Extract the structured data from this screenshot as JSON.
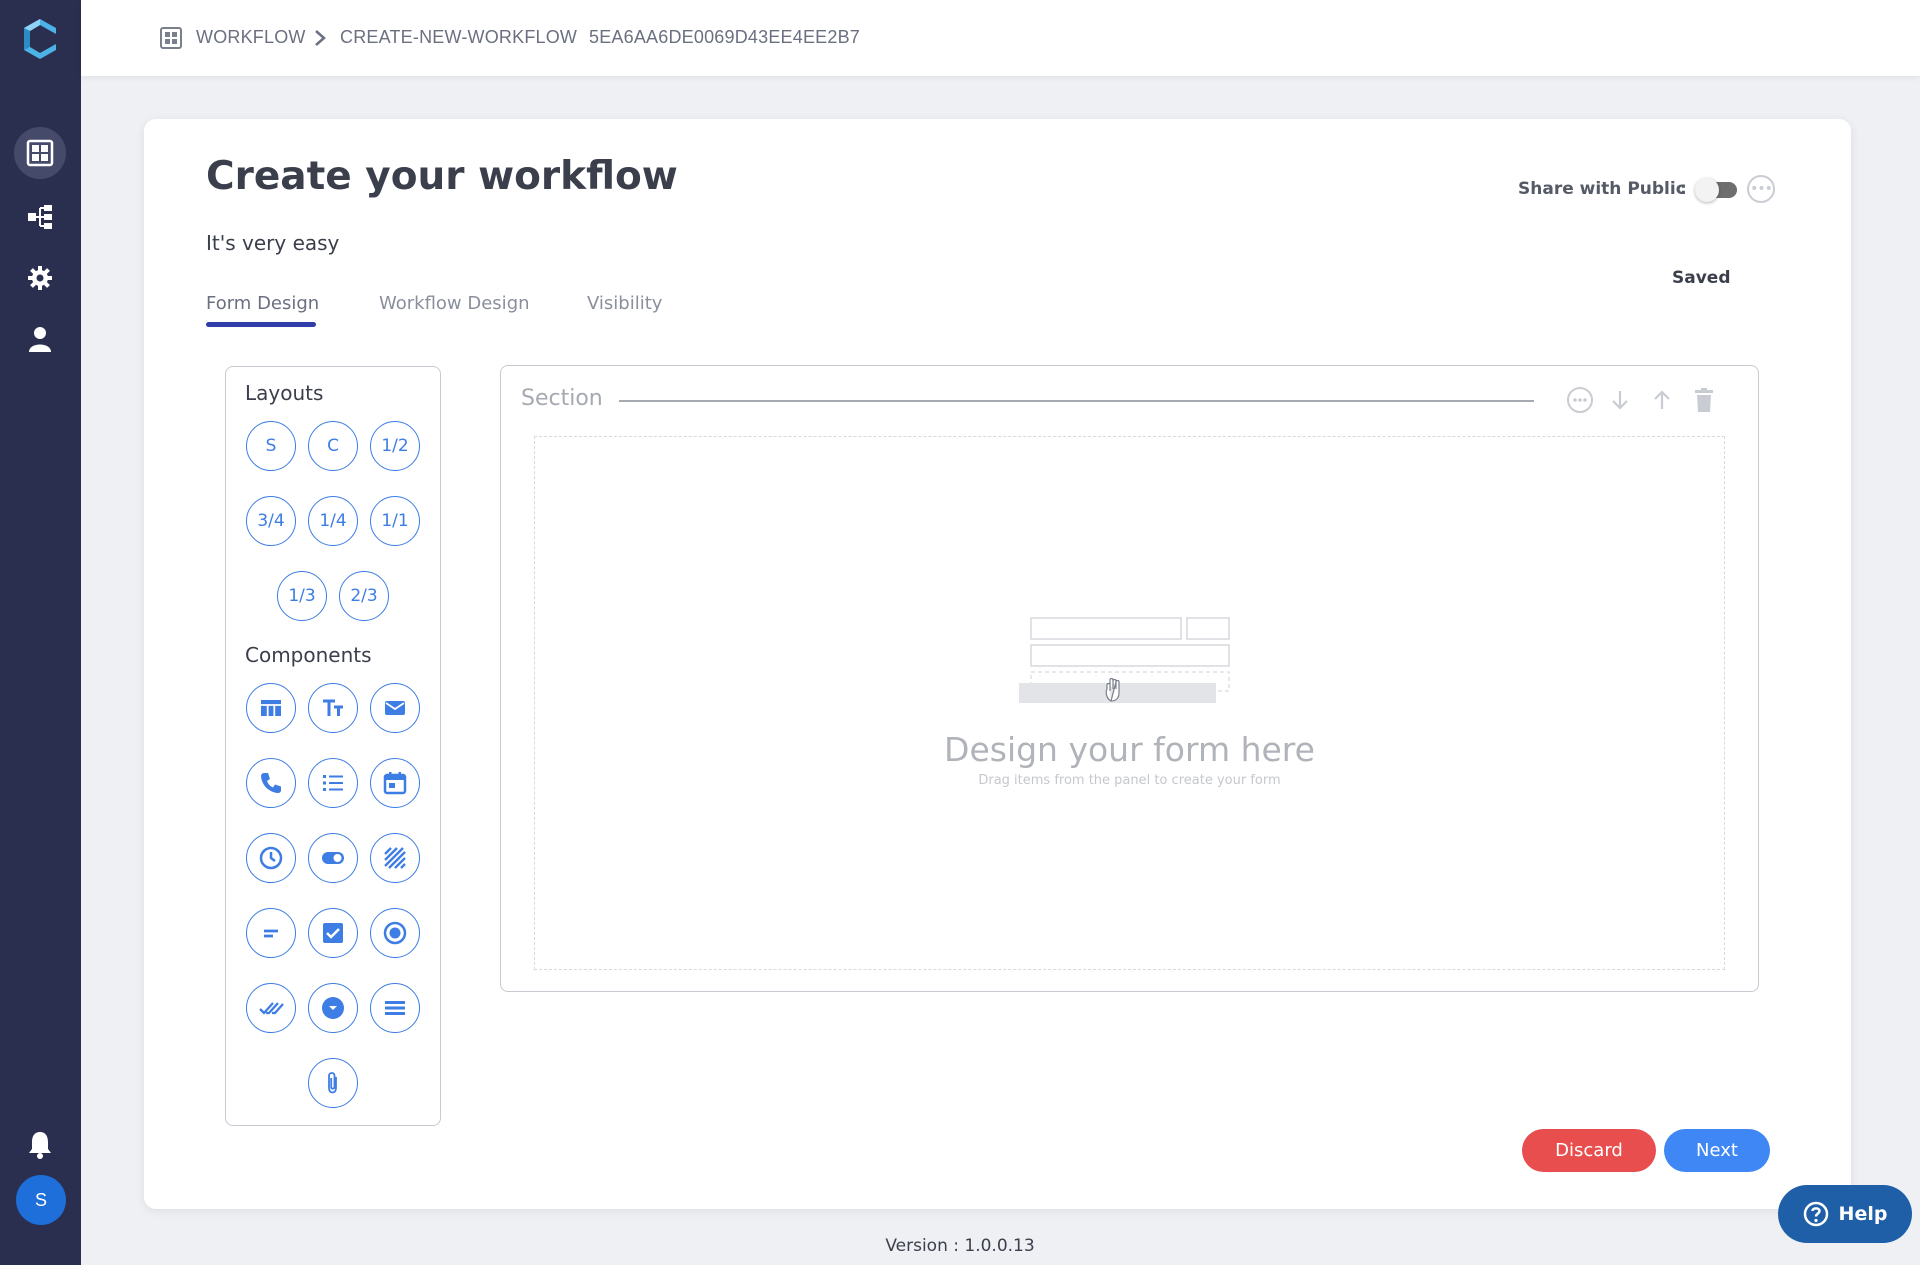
{
  "breadcrumb": {
    "root": "WORKFLOW",
    "current": "CREATE-NEW-WORKFLOW",
    "id": "5EA6AA6DE0069D43EE4EE2B7"
  },
  "page": {
    "title": "Create your workflow",
    "subtitle": "It's very easy",
    "share_label": "Share with Public",
    "share_colon": ":",
    "share_enabled": false,
    "status": "Saved"
  },
  "tabs": [
    {
      "label": "Form Design",
      "active": true
    },
    {
      "label": "Workflow Design",
      "active": false
    },
    {
      "label": "Visibility",
      "active": false
    }
  ],
  "palette": {
    "layouts_heading": "Layouts",
    "layouts": [
      "S",
      "C",
      "1/2",
      "3/4",
      "1/4",
      "1/1",
      "1/3",
      "2/3"
    ],
    "components_heading": "Components",
    "components": [
      "table-icon",
      "text-format-icon",
      "email-icon",
      "phone-icon",
      "list-icon",
      "calendar-icon",
      "clock-icon",
      "toggle-icon",
      "hatch-icon",
      "short-text-icon",
      "checkbox-icon",
      "radio-icon",
      "double-check-icon",
      "dropdown-icon",
      "menu-lines-icon",
      "attachment-icon"
    ]
  },
  "section": {
    "title": "Section",
    "empty_title": "Design your form here",
    "empty_subtitle": "Drag items from the panel to create your form"
  },
  "actions": {
    "discard": "Discard",
    "next": "Next"
  },
  "footer": {
    "version": "Version : 1.0.0.13",
    "help": "Help"
  },
  "user": {
    "avatar_initial": "S"
  },
  "colors": {
    "sidebar": "#2b2f4f",
    "accent": "#3d7de4",
    "discard": "#e84e4e",
    "next": "#3f87f5",
    "help": "#1e5fa8"
  }
}
